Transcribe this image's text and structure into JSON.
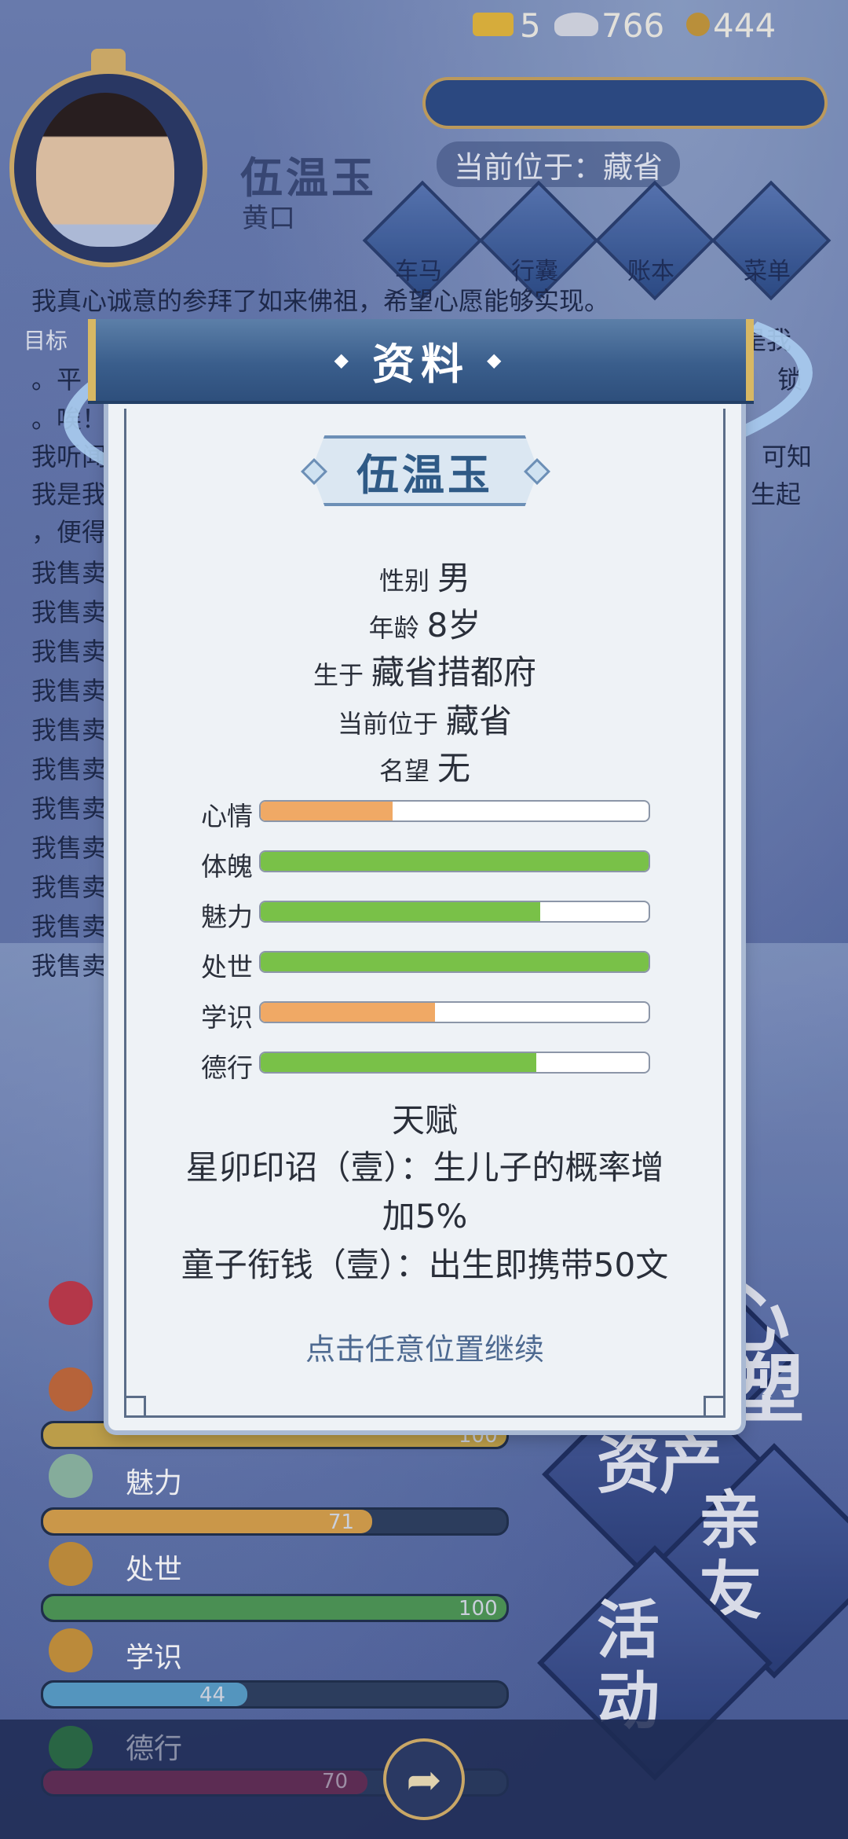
{
  "header": {
    "player_name": "伍温玉",
    "player_title": "黄口",
    "currency": [
      {
        "icon": "gold-ingot-icon",
        "value": "5",
        "color": "#e6b93b"
      },
      {
        "icon": "silver-ingot-icon",
        "value": "766",
        "color": "#d9dde6"
      },
      {
        "icon": "copper-coin-icon",
        "value": "444",
        "color": "#c79a3a"
      }
    ],
    "location": "当前位于：藏省",
    "menu": [
      {
        "label": "车马",
        "icon": "carriage-icon"
      },
      {
        "label": "行囊",
        "icon": "bag-icon"
      },
      {
        "label": "账本",
        "icon": "ledger-icon"
      },
      {
        "label": "菜单",
        "icon": "menu-dots-icon"
      }
    ]
  },
  "story": {
    "goal_label": "目标",
    "lines": [
      "我真心诚意的参拜了如来佛祖，希望心愿能够实现。",
      "我售卖",
      "我售卖",
      "我售卖",
      "我售卖",
      "我售卖",
      "我售卖",
      "我售卖",
      "我售卖",
      "我售卖",
      "我售卖",
      "我售卖"
    ],
    "fragments": [
      "是我",
      "。平",
      "。唉！",
      "我听闻",
      "我是我",
      "，便得",
      "锁",
      "可知",
      "生起"
    ]
  },
  "bg_stats": [
    {
      "label": "魅力",
      "value": 71,
      "fill_color": "#d9a24a",
      "icon": "charm-icon"
    },
    {
      "label": "处世",
      "value": 100,
      "fill_color": "#4f9a55",
      "icon": "worldly-icon"
    },
    {
      "label": "学识",
      "value": 44,
      "fill_color": "#5aa0c9",
      "icon": "knowledge-icon"
    },
    {
      "label": "德行",
      "value": 70,
      "fill_color": "#8a2b4f",
      "icon": "virtue-icon"
    }
  ],
  "bg_partial_numbers": [
    "100"
  ],
  "big_buttons": [
    "心",
    "塑",
    "资产",
    "亲友",
    "活动"
  ],
  "modal": {
    "title": "资料",
    "name": "伍温玉",
    "info": [
      {
        "label": "性别",
        "value": "男"
      },
      {
        "label": "年龄",
        "value": "8岁"
      },
      {
        "label": "生于",
        "value": "藏省措都府"
      },
      {
        "label": "当前位于",
        "value": "藏省"
      },
      {
        "label": "名望",
        "value": "无"
      }
    ],
    "attributes": [
      {
        "label": "心情",
        "value": 0.34,
        "color": "#f0a965"
      },
      {
        "label": "体魄",
        "value": 1.0,
        "color": "#79c148"
      },
      {
        "label": "魅力",
        "value": 0.72,
        "color": "#79c148"
      },
      {
        "label": "处世",
        "value": 1.0,
        "color": "#79c148"
      },
      {
        "label": "学识",
        "value": 0.45,
        "color": "#f0a965"
      },
      {
        "label": "德行",
        "value": 0.71,
        "color": "#79c148"
      }
    ],
    "talent_title": "天赋",
    "talents": [
      "星卯印诏（壹）：生儿子的概率增",
      "加5%",
      "童子衔钱（壹）：出生即携带50文"
    ],
    "continue_hint": "点击任意位置继续"
  }
}
